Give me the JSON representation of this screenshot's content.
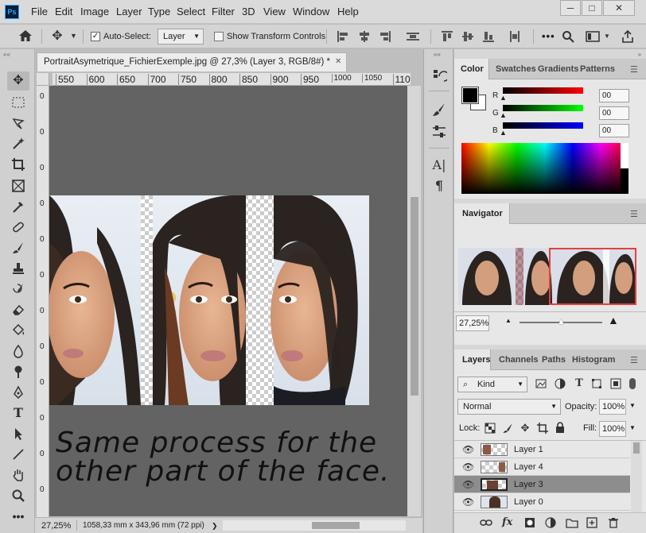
{
  "app": {
    "logo_text": "Ps"
  },
  "menu": [
    "File",
    "Edit",
    "Image",
    "Layer",
    "Type",
    "Select",
    "Filter",
    "3D",
    "View",
    "Window",
    "Help"
  ],
  "window_controls": {
    "minimize": "─",
    "maximize": "□",
    "close": "✕"
  },
  "options_bar": {
    "auto_select_label": "Auto-Select:",
    "auto_select_checked": true,
    "auto_select_target": "Layer",
    "show_transform_label": "Show Transform Controls",
    "show_transform_checked": false,
    "more_label": "•••"
  },
  "document": {
    "tab_title": "PortraitAsymetrique_FichierExemple.jpg @ 27,3% (Layer 3, RGB/8#) *",
    "tab_close": "✕",
    "h_ruler_ticks": [
      "550",
      "600",
      "650",
      "700",
      "750",
      "800",
      "850",
      "900",
      "950",
      "1000",
      "1050",
      "110"
    ],
    "v_ruler_ticks": [
      "0",
      "0",
      "0",
      "0",
      "0",
      "0",
      "0",
      "0",
      "0",
      "0",
      "0",
      "0"
    ],
    "annotation_line1": "Same process for the",
    "annotation_line2": "other part of the face.",
    "status_zoom": "27,25%",
    "status_info": "1058,33 mm x 343,96 mm (72 ppi)",
    "status_arrow": "❯"
  },
  "color_panel": {
    "tabs": [
      "Color",
      "Swatches",
      "Gradients",
      "Patterns"
    ],
    "channels": [
      {
        "label": "R",
        "value": "00",
        "color": "#ff0000"
      },
      {
        "label": "G",
        "value": "00",
        "color": "#00ff00"
      },
      {
        "label": "B",
        "value": "00",
        "color": "#0000ff"
      }
    ],
    "foreground": "#000000",
    "background": "#ffffff"
  },
  "navigator": {
    "title": "Navigator",
    "zoom": "27,25%",
    "slider_fraction": 0.5
  },
  "layers_panel": {
    "tabs": [
      "Layers",
      "Channels",
      "Paths",
      "Histogram"
    ],
    "filter_kind": "Kind",
    "blend_mode": "Normal",
    "opacity_label": "Opacity:",
    "opacity_value": "100%",
    "lock_label": "Lock:",
    "fill_label": "Fill:",
    "fill_value": "100%",
    "layers": [
      {
        "name": "Layer 1",
        "selected": false
      },
      {
        "name": "Layer 4",
        "selected": false
      },
      {
        "name": "Layer 3",
        "selected": true
      },
      {
        "name": "Layer 0",
        "selected": false
      }
    ],
    "footer_icons": [
      "link-icon",
      "fx-icon",
      "mask-icon",
      "adjustment-icon",
      "folder-icon",
      "new-layer-icon",
      "trash-icon"
    ],
    "footer_fx": "fx"
  },
  "colors": {
    "canvas": "#636363",
    "panel": "#d7d7d7",
    "selected_layer": "#8d8d8d",
    "navigator_box": "#e34040"
  }
}
